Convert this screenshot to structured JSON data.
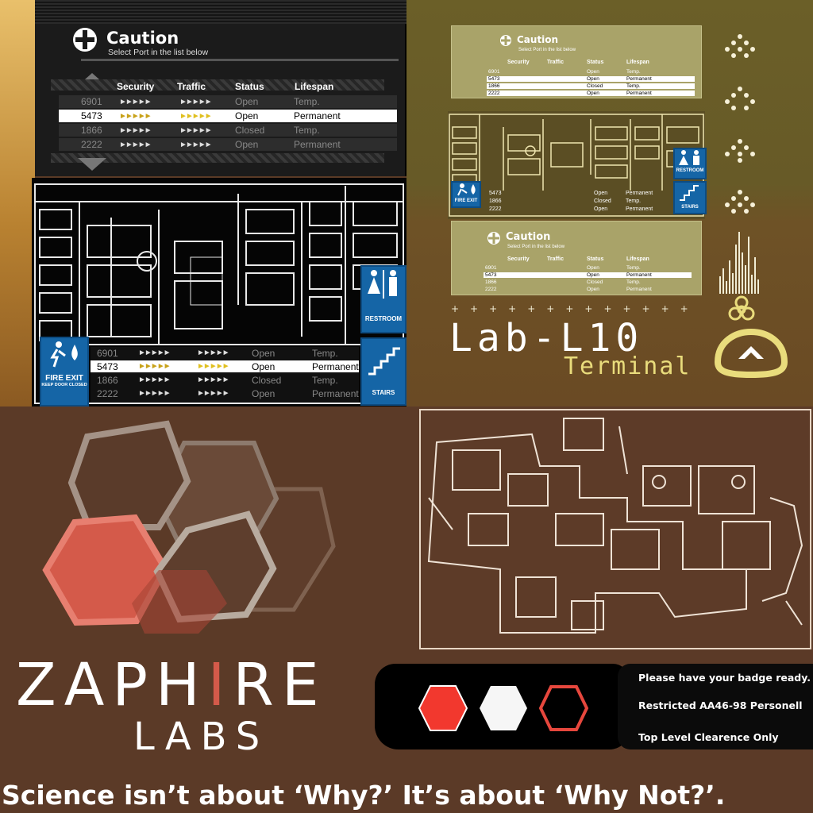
{
  "caution_panel": {
    "title": "Caution",
    "subtitle": "Select Port in the list below",
    "columns": [
      "Security",
      "Traffic",
      "Status",
      "Lifespan"
    ],
    "rows": [
      {
        "port": "6901",
        "status": "Open",
        "lifespan": "Temp."
      },
      {
        "port": "5473",
        "status": "Open",
        "lifespan": "Permanent",
        "selected": true
      },
      {
        "port": "1866",
        "status": "Closed",
        "lifespan": "Temp."
      },
      {
        "port": "2222",
        "status": "Open",
        "lifespan": "Permanent"
      }
    ]
  },
  "signs": {
    "restroom": "RESTROOM",
    "fire_exit": "FIRE EXIT",
    "fire_exit_sub": "KEEP DOOR CLOSED",
    "stairs": "STAIRS"
  },
  "terminal": {
    "title": "Lab-L10",
    "subtitle": "Terminal",
    "accent": "#e9dc7c"
  },
  "brand": {
    "name_left": "ZAPH",
    "name_mid": "I",
    "name_right": "RE",
    "sub": "LABS",
    "accent": "#d45a4a"
  },
  "notice": {
    "line1": "Please have your badge ready.",
    "line2": "Restricted AA46-98 Personell",
    "line3": "Top Level Clearence Only"
  },
  "tagline": "Science isn’t about ‘Why?’ It’s about ‘Why Not?’."
}
